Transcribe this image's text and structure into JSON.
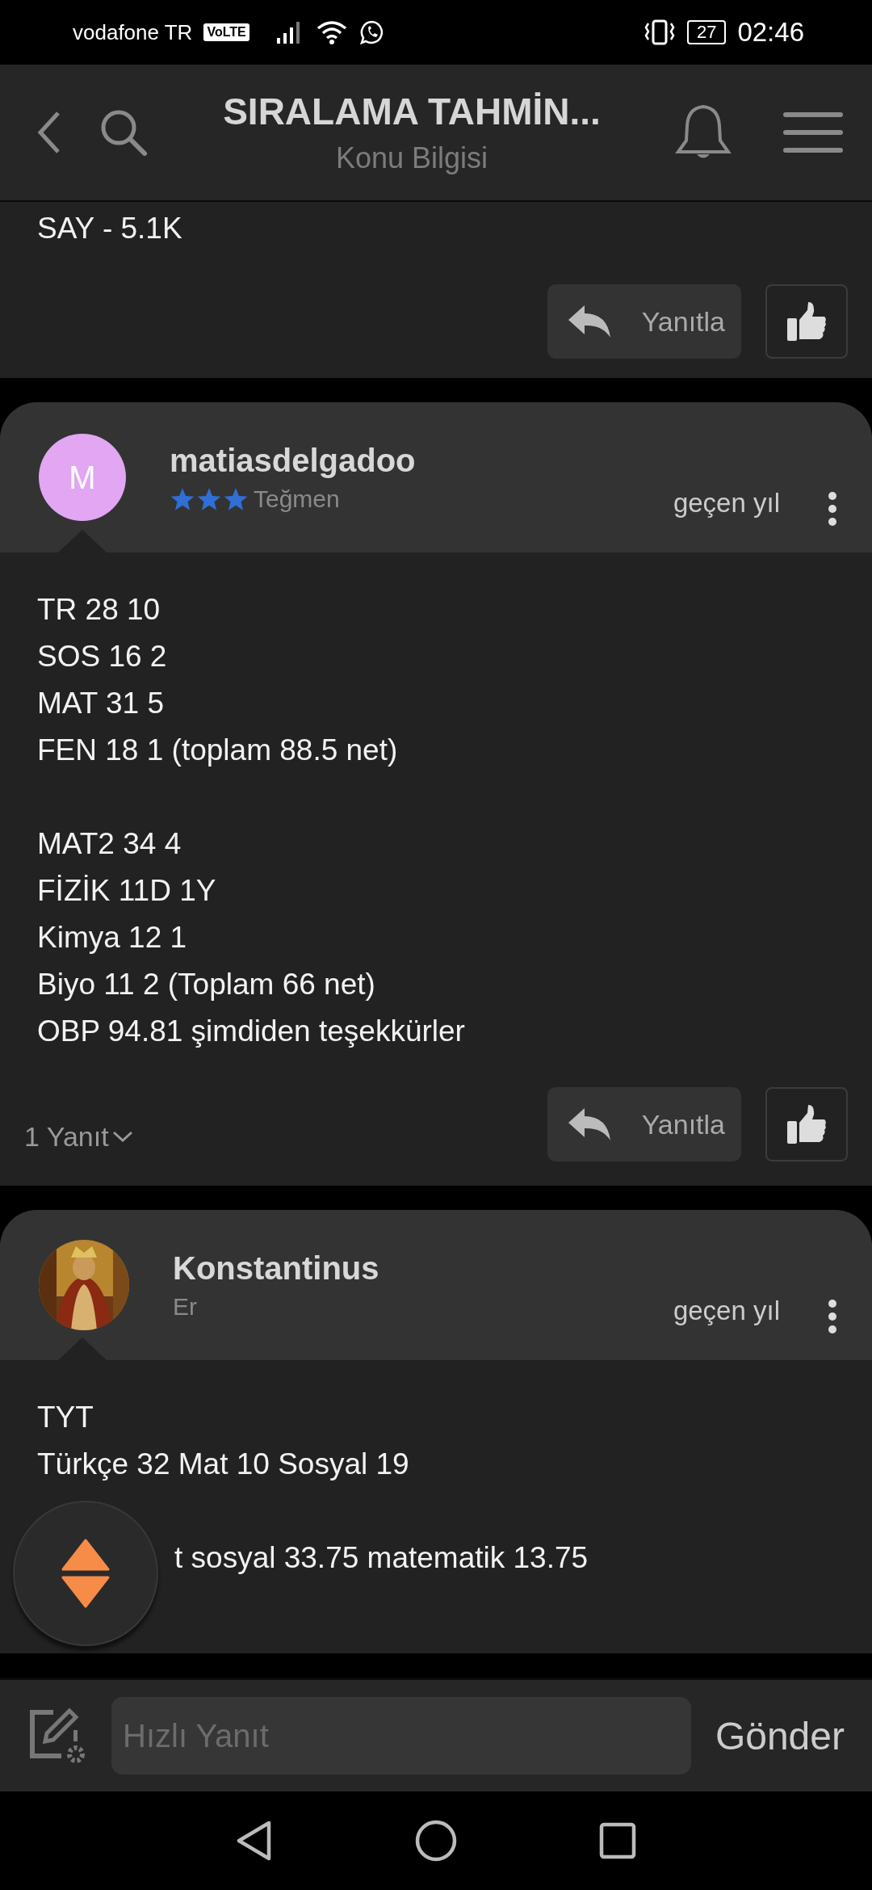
{
  "status_bar": {
    "carrier": "vodafone TR",
    "volte": "VoLTE",
    "battery": "27",
    "time": "02:46"
  },
  "header": {
    "title": "SIRALAMA TAHMİN...",
    "subtitle": "Konu Bilgisi"
  },
  "posts": [
    {
      "body": [
        [
          "SAY - 5.1K"
        ]
      ],
      "reply_button": "Yanıtla"
    },
    {
      "author": "matiasdelgadoo",
      "avatar": {
        "kind": "initial",
        "letter": "M",
        "color": "#e2a6f2"
      },
      "stars": 3,
      "rank": "Teğmen",
      "time": "geçen yıl",
      "body": [
        [
          "TR 28 10",
          "SOS 16 2",
          "MAT 31 5",
          "FEN 18 1 (toplam 88.5 net)"
        ],
        [
          "MAT2 34 4",
          "FİZİK 11D 1Y",
          "Kimya 12 1",
          "Biyo 11 2 (Toplam 66 net)",
          "OBP 94.81 şimdiden teşekkürler"
        ]
      ],
      "replies": "1 Yanıt",
      "reply_button": "Yanıtla"
    },
    {
      "author": "Konstantinus",
      "avatar": {
        "kind": "picture"
      },
      "rank": "Er",
      "time": "geçen yıl",
      "partly_covered": true,
      "body": [
        [
          "TYT",
          "Türkçe 32 Mat 10 Sosyal 19"
        ],
        [
          "t sosyal 33.75 matematik 13.75"
        ]
      ]
    }
  ],
  "reply_bar": {
    "placeholder": "Hızlı Yanıt",
    "send": "Gönder"
  }
}
